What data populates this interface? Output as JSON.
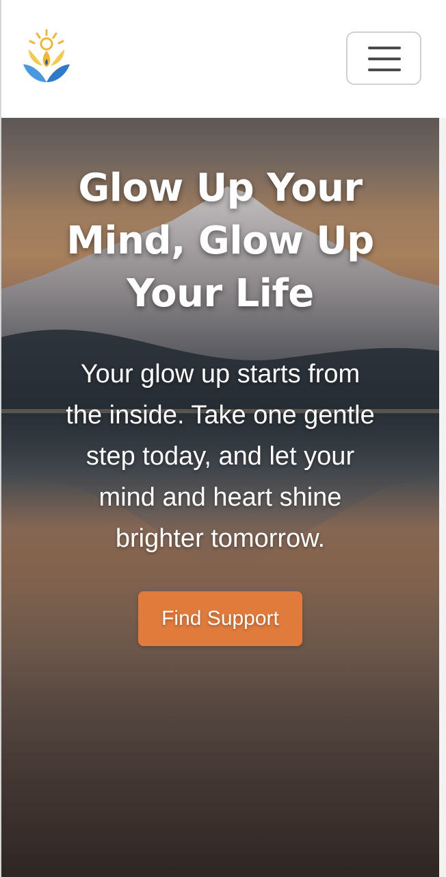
{
  "header": {
    "logo_icon": "sun-lotus-logo-icon",
    "menu_icon": "hamburger-menu-icon"
  },
  "hero": {
    "title": "Glow Up Your Mind, Glow Up Your Life",
    "text": "Your glow up starts from the inside. Take one gentle step today, and let your mind and heart shine brighter tomorrow.",
    "cta_label": "Find Support",
    "background": "mountain-lake-sunset-image"
  },
  "colors": {
    "accent": "#e07b3c",
    "logo_sun": "#f2b632",
    "logo_leaf": "#3a86d4"
  }
}
